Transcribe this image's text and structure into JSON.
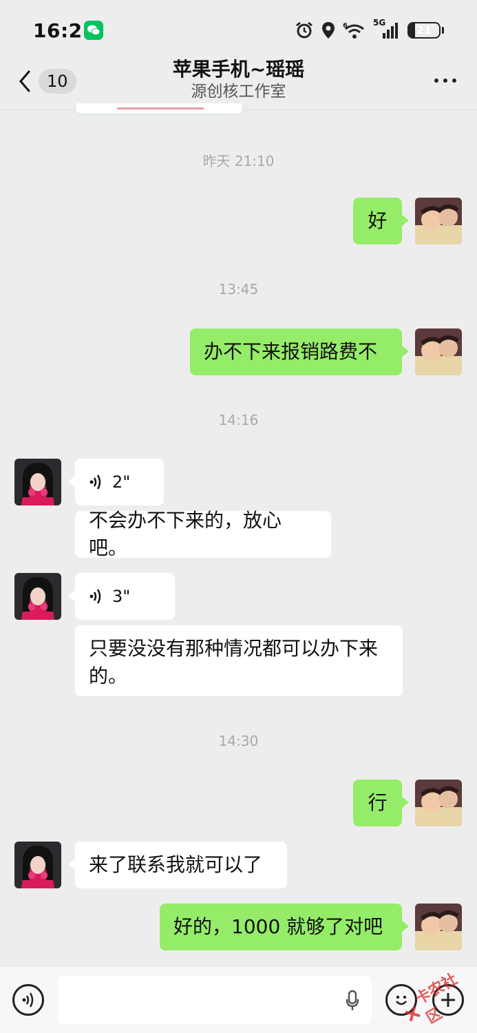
{
  "status_bar": {
    "time": "16:21",
    "network": "5G",
    "wifi_badge": "6",
    "battery": "21",
    "battery_fraction": 0.21
  },
  "header": {
    "back_count": "10",
    "title": "苹果手机~瑶瑶",
    "subtitle": "源创核工作室"
  },
  "chat": {
    "timestamps": [
      "昨天 21:10",
      "13:45",
      "14:16",
      "14:30"
    ],
    "messages": [
      {
        "sender": "me",
        "text": "好"
      },
      {
        "sender": "me",
        "text": "办不下来报销路费不"
      },
      {
        "sender": "other",
        "type": "voice",
        "duration": "2\""
      },
      {
        "sender": "other",
        "text": "不会办不下来的，放心吧。"
      },
      {
        "sender": "other",
        "type": "voice",
        "duration": "3\""
      },
      {
        "sender": "other",
        "text": "只要没没有那种情况都可以办下来的。"
      },
      {
        "sender": "me",
        "text": "行"
      },
      {
        "sender": "other",
        "text": "来了联系我就可以了"
      },
      {
        "sender": "me",
        "text": "好的，1000 就够了对吧"
      }
    ]
  },
  "input_bar": {
    "voice_icon": "voice-toggle-icon",
    "emoji_icon": "emoji-icon",
    "plus_icon": "plus-icon",
    "mic_icon": "mic-icon"
  },
  "watermark": "卡农社区",
  "colors": {
    "my_bubble": "#95ec69",
    "other_bubble": "#ffffff",
    "background": "#ededed",
    "wechat_green": "#07c160"
  }
}
